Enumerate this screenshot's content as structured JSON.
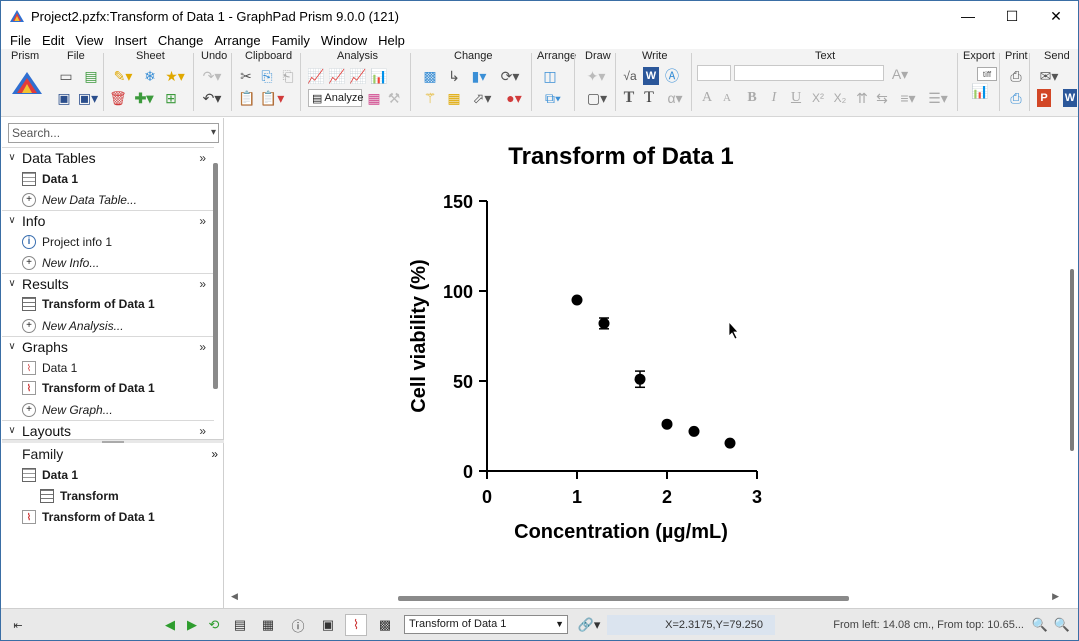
{
  "window": {
    "title": "Project2.pzfx:Transform of Data 1 - GraphPad Prism 9.0.0 (121)",
    "minimize": "—",
    "maximize": "☐",
    "close": "✕"
  },
  "menu": [
    "File",
    "Edit",
    "View",
    "Insert",
    "Change",
    "Arrange",
    "Family",
    "Window",
    "Help"
  ],
  "ribbon": {
    "groups": {
      "prism": "Prism",
      "file": "File",
      "sheet": "Sheet",
      "undo": "Undo",
      "clipboard": "Clipboard",
      "analysis": "Analysis",
      "change": "Change",
      "arrange": "Arrange",
      "draw": "Draw",
      "write": "Write",
      "text": "Text",
      "export": "Export",
      "print": "Print",
      "send": "Send"
    },
    "analyze_label": "Analyze",
    "sqrt_label": "√a",
    "word_label": "W",
    "T1": "T",
    "T2": "T",
    "alpha": "α",
    "bold": "B",
    "italic": "I",
    "underline": "U",
    "sup": "X²",
    "sub": "X₂",
    "ppt": "P",
    "word2": "W",
    "tiff": "tiff"
  },
  "navigator": {
    "search_placeholder": "Search...",
    "sections": {
      "data_tables": {
        "label": "Data Tables",
        "items": [
          "Data 1",
          "New Data Table..."
        ]
      },
      "info": {
        "label": "Info",
        "items": [
          "Project info 1",
          "New Info..."
        ]
      },
      "results": {
        "label": "Results",
        "items": [
          "Transform of Data 1",
          "New Analysis..."
        ]
      },
      "graphs": {
        "label": "Graphs",
        "items": [
          "Data 1",
          "Transform of Data 1",
          "New Graph..."
        ]
      },
      "layouts": {
        "label": "Layouts"
      }
    },
    "more": "»",
    "family": {
      "label": "Family",
      "items": [
        "Data 1",
        "Transform",
        "Transform of Data 1"
      ]
    }
  },
  "status": {
    "sheet_name": "Transform of Data 1",
    "coords": "X=2.3175,Y=79.250",
    "position": "From left: 14.08 cm., From top: 10.65..."
  },
  "chart_data": {
    "type": "scatter",
    "title": "Transform of Data 1",
    "xlabel": "Concentration (µg/mL)",
    "ylabel": "Cell viability (%)",
    "xlim": [
      0,
      3
    ],
    "ylim": [
      0,
      150
    ],
    "xticks": [
      "0",
      "1",
      "2",
      "3"
    ],
    "yticks": [
      "0",
      "50",
      "100",
      "150"
    ],
    "points": [
      {
        "x": 1.0,
        "y": 95,
        "err": 0
      },
      {
        "x": 1.3,
        "y": 82,
        "err": 3
      },
      {
        "x": 1.7,
        "y": 51,
        "err": 4.5
      },
      {
        "x": 2.0,
        "y": 26,
        "err": 0
      },
      {
        "x": 2.3,
        "y": 22,
        "err": 0
      },
      {
        "x": 2.7,
        "y": 15.5,
        "err": 0
      }
    ],
    "marker_color": "#000000"
  }
}
